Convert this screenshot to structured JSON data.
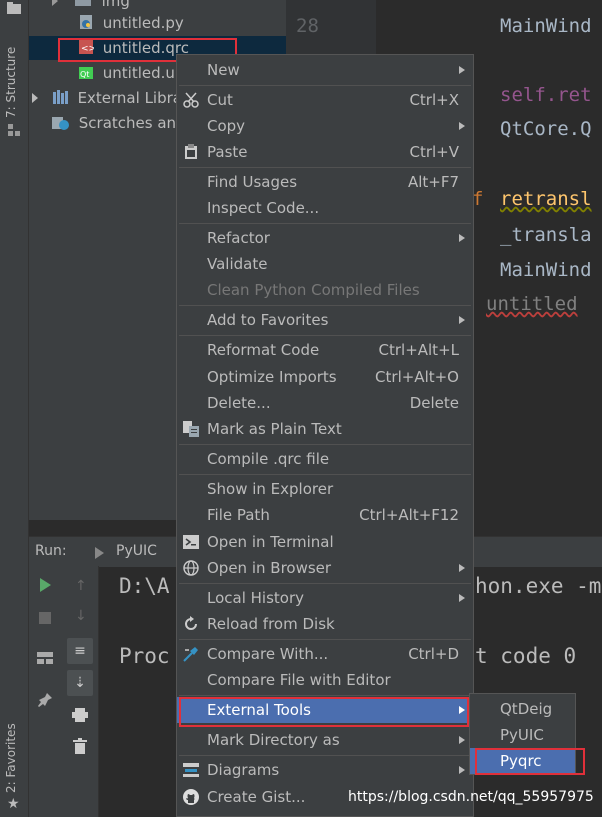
{
  "sidebar": {
    "structure_tab": "7: Structure",
    "favorites_tab": "2: Favorites"
  },
  "project_tree": {
    "items": [
      {
        "label": "img",
        "icon": "folder-icon"
      },
      {
        "label": "untitled.py",
        "icon": "python-file-icon"
      },
      {
        "label": "untitled.qrc",
        "icon": "qrc-file-icon"
      },
      {
        "label": "untitled.ui",
        "icon": "qt-ui-file-icon"
      },
      {
        "label": "External Libraries",
        "icon": "library-icon"
      },
      {
        "label": "Scratches and",
        "icon": "scratches-icon"
      }
    ]
  },
  "editor": {
    "line_number": "28",
    "lines": [
      "MainWind",
      "self.ret",
      "QtCore.Q",
      "retransl",
      "_transla",
      "MainWind",
      "untitled"
    ],
    "keyword_f": "f"
  },
  "run_panel": {
    "label": "Run:",
    "tab": "PyUIC",
    "console_line1_left": "D:\\A",
    "console_line1_right": "hon.exe -m",
    "console_line2_left": "Proc",
    "console_line2_right": "t code 0"
  },
  "context_menu": {
    "items": [
      {
        "label": "New",
        "shortcut": "",
        "submenu": true
      },
      {
        "label": "Cut",
        "shortcut": "Ctrl+X",
        "submenu": false
      },
      {
        "label": "Copy",
        "shortcut": "",
        "submenu": true
      },
      {
        "label": "Paste",
        "shortcut": "Ctrl+V",
        "submenu": false
      },
      {
        "label": "Find Usages",
        "shortcut": "Alt+F7",
        "submenu": false
      },
      {
        "label": "Inspect Code...",
        "shortcut": "",
        "submenu": false
      },
      {
        "label": "Refactor",
        "shortcut": "",
        "submenu": true
      },
      {
        "label": "Validate",
        "shortcut": "",
        "submenu": false
      },
      {
        "label": "Clean Python Compiled Files",
        "shortcut": "",
        "submenu": false,
        "disabled": true
      },
      {
        "label": "Add to Favorites",
        "shortcut": "",
        "submenu": true
      },
      {
        "label": "Reformat Code",
        "shortcut": "Ctrl+Alt+L",
        "submenu": false
      },
      {
        "label": "Optimize Imports",
        "shortcut": "Ctrl+Alt+O",
        "submenu": false
      },
      {
        "label": "Delete...",
        "shortcut": "Delete",
        "submenu": false
      },
      {
        "label": "Mark as Plain Text",
        "shortcut": "",
        "submenu": false
      },
      {
        "label": "Compile .qrc file",
        "shortcut": "",
        "submenu": false
      },
      {
        "label": "Show in Explorer",
        "shortcut": "",
        "submenu": false
      },
      {
        "label": "File Path",
        "shortcut": "Ctrl+Alt+F12",
        "submenu": false
      },
      {
        "label": "Open in Terminal",
        "shortcut": "",
        "submenu": false
      },
      {
        "label": "Open in Browser",
        "shortcut": "",
        "submenu": true
      },
      {
        "label": "Local History",
        "shortcut": "",
        "submenu": true
      },
      {
        "label": "Reload from Disk",
        "shortcut": "",
        "submenu": false
      },
      {
        "label": "Compare With...",
        "shortcut": "Ctrl+D",
        "submenu": false
      },
      {
        "label": "Compare File with Editor",
        "shortcut": "",
        "submenu": false
      },
      {
        "label": "External Tools",
        "shortcut": "",
        "submenu": true,
        "active": true
      },
      {
        "label": "Mark Directory as",
        "shortcut": "",
        "submenu": true
      },
      {
        "label": "Diagrams",
        "shortcut": "",
        "submenu": true
      },
      {
        "label": "Create Gist...",
        "shortcut": "",
        "submenu": false
      }
    ]
  },
  "external_tools_submenu": {
    "items": [
      {
        "label": "QtDeig"
      },
      {
        "label": "PyUIC"
      },
      {
        "label": "Pyqrc",
        "active": true
      }
    ]
  },
  "watermark": "https://blog.csdn.net/qq_55957975",
  "colors": {
    "menu_bg": "#3c3f41",
    "highlight": "#4b6eaf",
    "annotation_red": "#e0303a",
    "editor_bg": "#2b2b2b"
  }
}
